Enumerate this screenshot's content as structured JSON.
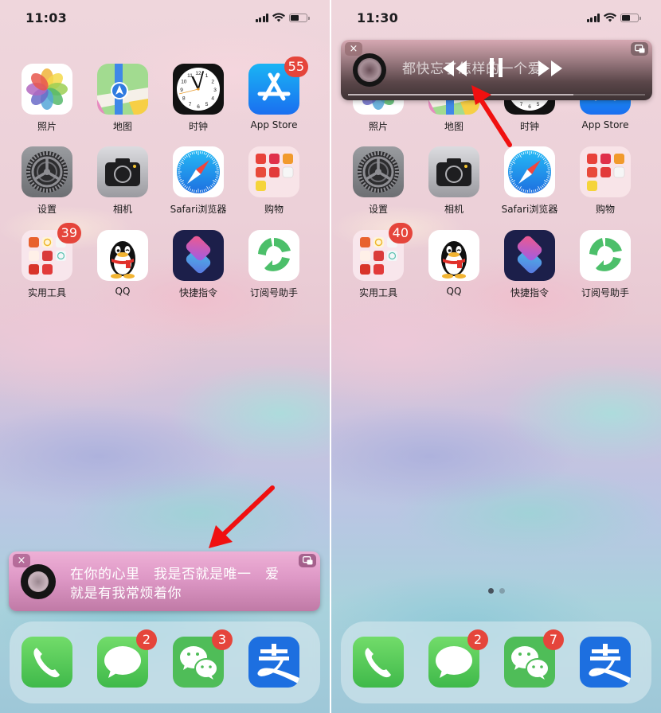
{
  "panels": [
    {
      "status": {
        "time": "11:03",
        "battery_level": 0.55
      },
      "grid_apps": [
        {
          "name": "照片",
          "icon": "photos-icon",
          "badge": null
        },
        {
          "name": "地图",
          "icon": "maps-icon",
          "badge": null
        },
        {
          "name": "时钟",
          "icon": "clock-icon",
          "badge": null
        },
        {
          "name": "App Store",
          "icon": "app-store-icon",
          "badge": "55"
        },
        {
          "name": "设置",
          "icon": "settings-icon",
          "badge": null
        },
        {
          "name": "相机",
          "icon": "camera-icon",
          "badge": null
        },
        {
          "name": "Safari浏览器",
          "icon": "safari-icon",
          "badge": null
        },
        {
          "name": "购物",
          "icon": "shopping-folder-icon",
          "badge": null
        },
        {
          "name": "实用工具",
          "icon": "utilities-folder-icon",
          "badge": "39"
        },
        {
          "name": "QQ",
          "icon": "qq-icon",
          "badge": null
        },
        {
          "name": "快捷指令",
          "icon": "shortcuts-icon",
          "badge": null
        },
        {
          "name": "订阅号助手",
          "icon": "subscription-assistant-icon",
          "badge": null
        }
      ],
      "dock_apps": [
        {
          "name": "电话",
          "icon": "phone-icon",
          "badge": null
        },
        {
          "name": "信息",
          "icon": "messages-icon",
          "badge": "2"
        },
        {
          "name": "微信",
          "icon": "wechat-icon",
          "badge": "3"
        },
        {
          "name": "支付宝",
          "icon": "alipay-icon",
          "badge": null
        }
      ],
      "lyrics_banner": {
        "line1": "在你的心里　我是否就是唯一　爱",
        "line2": "就是有我常烦着你",
        "close_icon": "×",
        "pip_icon": "pip-icon"
      }
    },
    {
      "status": {
        "time": "11:30",
        "battery_level": 0.55
      },
      "grid_apps": [
        {
          "name": "照片",
          "icon": "photos-icon",
          "badge": null
        },
        {
          "name": "地图",
          "icon": "maps-icon",
          "badge": null
        },
        {
          "name": "时钟",
          "icon": "clock-icon",
          "badge": null
        },
        {
          "name": "App Store",
          "icon": "app-store-icon",
          "badge": null
        },
        {
          "name": "设置",
          "icon": "settings-icon",
          "badge": null
        },
        {
          "name": "相机",
          "icon": "camera-icon",
          "badge": null
        },
        {
          "name": "Safari浏览器",
          "icon": "safari-icon",
          "badge": null
        },
        {
          "name": "购物",
          "icon": "shopping-folder-icon",
          "badge": null
        },
        {
          "name": "实用工具",
          "icon": "utilities-folder-icon",
          "badge": "40"
        },
        {
          "name": "QQ",
          "icon": "qq-icon",
          "badge": null
        },
        {
          "name": "快捷指令",
          "icon": "shortcuts-icon",
          "badge": null
        },
        {
          "name": "订阅号助手",
          "icon": "subscription-assistant-icon",
          "badge": null
        }
      ],
      "dock_apps": [
        {
          "name": "电话",
          "icon": "phone-icon",
          "badge": null
        },
        {
          "name": "信息",
          "icon": "messages-icon",
          "badge": "2"
        },
        {
          "name": "微信",
          "icon": "wechat-icon",
          "badge": "7"
        },
        {
          "name": "支付宝",
          "icon": "alipay-icon",
          "badge": null
        }
      ],
      "page_indicator": {
        "pages": 2,
        "current": 1
      },
      "player_banner": {
        "lyric": "都快忘了怎样的一个爱",
        "progress": 0.76,
        "controls": [
          "previous-icon",
          "pause-icon",
          "next-icon"
        ],
        "close_icon": "×",
        "pip_icon": "pip-icon"
      }
    }
  ],
  "colors": {
    "badge_red": "#e5453b",
    "annotation_arrow": "#f01010",
    "left_banner_top": "#e9a8d2",
    "left_banner_bottom": "#c276a6",
    "right_banner_top": "#c49aa3",
    "right_banner_bottom": "#3e3234"
  }
}
